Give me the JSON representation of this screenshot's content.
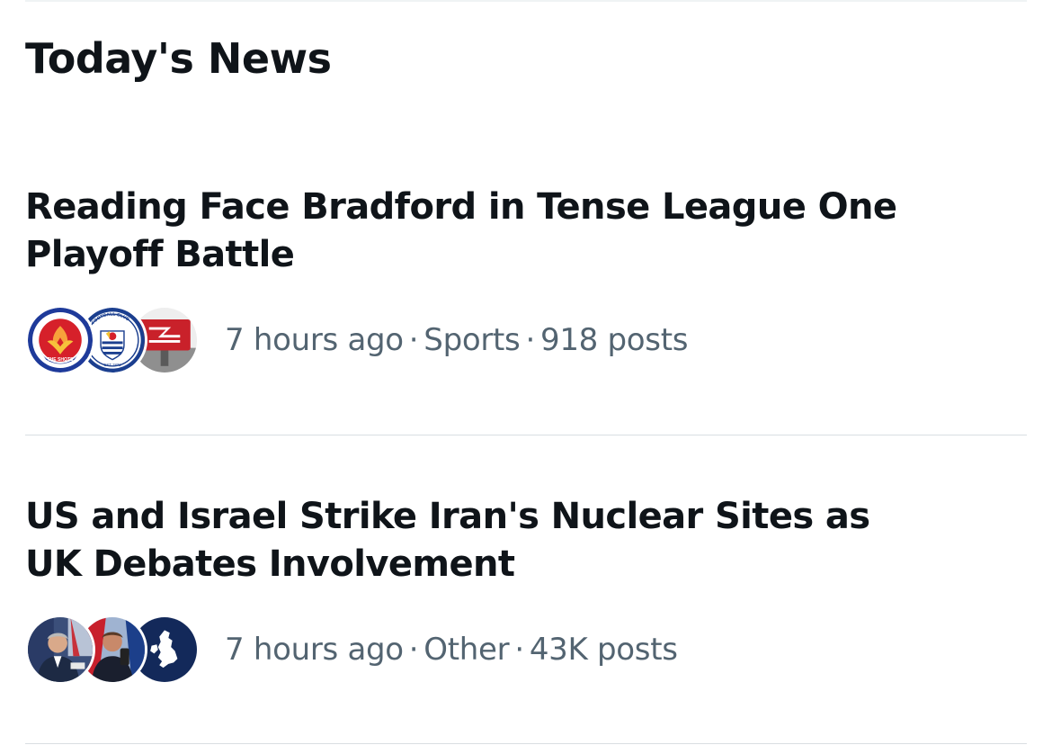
{
  "section": {
    "title": "Today's News"
  },
  "stories": [
    {
      "headline": "Reading Face Bradford in Tense League One Playoff Battle",
      "time": "7 hours ago",
      "category": "Sports",
      "posts": "918 posts",
      "separator": "·",
      "avatars": [
        {
          "icon": "aldershot-town-crest-icon",
          "ring_text": "ALDERSHOT TOWN F.C.",
          "bottom_text": "THE SHOTS"
        },
        {
          "icon": "reading-fc-crest-icon",
          "ring_text": "FOOTBALL CLUB",
          "bottom_text": "EST 1871"
        },
        {
          "icon": "national-rail-sign-icon"
        }
      ]
    },
    {
      "headline": "US and Israel Strike Iran's Nuclear Sites as UK Debates Involvement",
      "time": "7 hours ago",
      "category": "Other",
      "posts": "43K posts",
      "separator": "·",
      "avatars": [
        {
          "icon": "speaker-photo-avatar"
        },
        {
          "icon": "person-photo-avatar"
        },
        {
          "icon": "uk-map-icon"
        }
      ]
    }
  ],
  "colors": {
    "text_primary": "#0f1419",
    "text_secondary": "#536471",
    "divider": "#d9dee2",
    "aldershot_blue": "#1e3a9a",
    "aldershot_red": "#d6202a",
    "reading_blue": "#1b3f8f",
    "rail_red": "#c9212a",
    "uk_map_navy": "#13295a"
  }
}
